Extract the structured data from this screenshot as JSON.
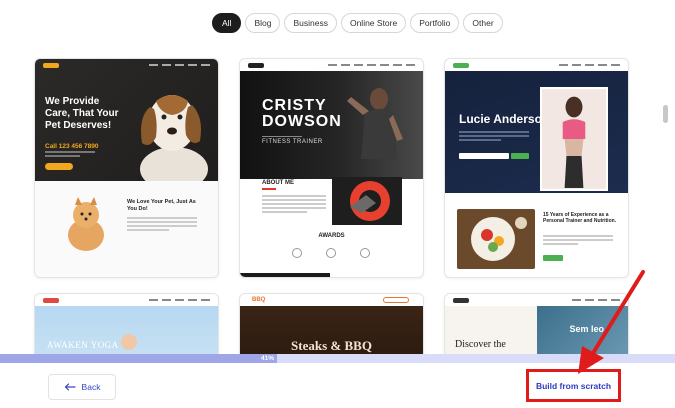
{
  "filters": {
    "items": [
      {
        "label": "All",
        "active": true
      },
      {
        "label": "Blog",
        "active": false
      },
      {
        "label": "Business",
        "active": false
      },
      {
        "label": "Online Store",
        "active": false
      },
      {
        "label": "Portfolio",
        "active": false
      },
      {
        "label": "Other",
        "active": false
      }
    ]
  },
  "templates": {
    "pet_care": {
      "headline": "We Provide Care, That Your Pet Deserves!",
      "phone": "Call 123 456 7890",
      "subhead": "We Love Your Pet, Just As You Do!"
    },
    "fitness_trainer": {
      "name_line1": "CRISTY",
      "name_line2": "DOWSON",
      "role": "FITNESS TRAINER",
      "about": "ABOUT ME",
      "awards": "AWARDS"
    },
    "personal_trainer": {
      "name": "Lucie Anderson",
      "headline": "15 Years of Experience as a Personal Trainer and Nutrition."
    },
    "yoga": {
      "headline": "AWAKEN YOGA"
    },
    "bbq": {
      "logo": "BBQ",
      "headline": "Steaks & BBQ"
    },
    "travel": {
      "headline_left": "Discover the",
      "headline_right": "Sem leo"
    }
  },
  "progress": {
    "percent_label": "41%",
    "value": 0.41
  },
  "footer": {
    "back_label": "Back",
    "build_label": "Build from scratch"
  },
  "colors": {
    "accent_blue": "#2f3ac2",
    "highlight_red": "#e01b1b",
    "progress_fill": "#9fa6e8",
    "progress_track": "#d9dcf8"
  }
}
